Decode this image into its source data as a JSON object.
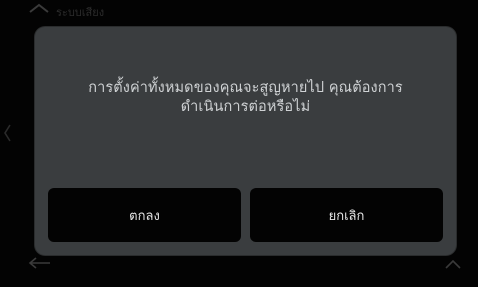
{
  "background": {
    "title": "ระบบเสียง",
    "icons": [
      "back-arrow-icon",
      "chevron-left-icon",
      "back-arrow-icon",
      "chevron-up-icon"
    ]
  },
  "dialog": {
    "message_line1": "การตั้งค่าทั้งหมดของคุณจะสูญหายไป คุณต้องการ",
    "message_line2": "ดำเนินการต่อหรือไม่",
    "confirm_label": "ตกลง",
    "cancel_label": "ยกเลิก"
  },
  "colors": {
    "dialog_bg": "#3a3d3f",
    "button_bg": "#030303",
    "text": "#cfd2d4"
  }
}
